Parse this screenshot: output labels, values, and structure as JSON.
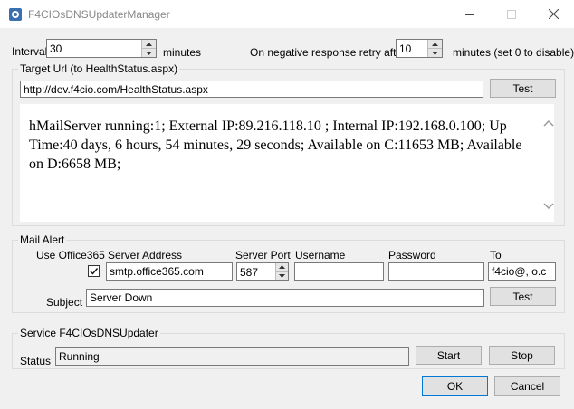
{
  "window": {
    "title": "F4CIOsDNSUpdaterManager"
  },
  "interval": {
    "label": "Interval",
    "value": "30",
    "unit": "minutes"
  },
  "retry": {
    "label": "On negative response retry after",
    "value": "10",
    "unit": "minutes (set 0 to disable)"
  },
  "target": {
    "group_title": "Target Url (to HealthStatus.aspx)",
    "url": "http://dev.f4cio.com/HealthStatus.aspx",
    "test_label": "Test",
    "response": "hMailServer running:1; External IP:89.216.118.10  ; Internal IP:192.168.0.100; Up Time:40 days, 6 hours, 54 minutes, 29 seconds; Available on C:11653 MB; Available on D:6658 MB;"
  },
  "mail": {
    "group_title": "Mail Alert",
    "use_office365_label": "Use Office365",
    "use_office365_checked": true,
    "server_address_label": "Server Address",
    "server_address": "smtp.office365.com",
    "server_port_label": "Server Port",
    "server_port": "587",
    "username_label": "Username",
    "username": "",
    "password_label": "Password",
    "password": "",
    "to_label": "To",
    "to": "f4cio@,    o.c",
    "subject_label": "Subject",
    "subject": "Server Down",
    "test_label": "Test"
  },
  "service": {
    "group_title": "Service F4CIOsDNSUpdater",
    "status_label": "Status",
    "status": "Running",
    "start_label": "Start",
    "stop_label": "Stop"
  },
  "dialog": {
    "ok_label": "OK",
    "cancel_label": "Cancel"
  },
  "icons": {
    "app": "app-gear-icon",
    "minimize": "minimize-icon",
    "maximize": "maximize-icon",
    "close": "close-icon"
  }
}
